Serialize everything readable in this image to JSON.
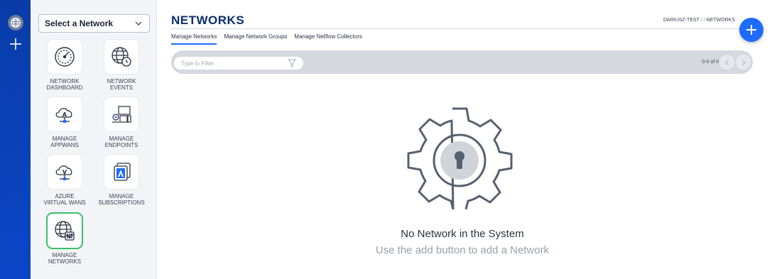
{
  "rail": {
    "icons": [
      "globe-icon",
      "plus-icon"
    ]
  },
  "sidebar": {
    "network_select": {
      "value": "Select a Network"
    },
    "tiles": [
      {
        "label": "NETWORK\nDASHBOARD",
        "icon": "dashboard-gauge-icon"
      },
      {
        "label": "NETWORK\nEVENTS",
        "icon": "globe-clock-icon"
      },
      {
        "label": "MANAGE\nAPPWANS",
        "icon": "cloud-a-icon"
      },
      {
        "label": "MANAGE\nENDPOINTS",
        "icon": "endpoints-devices-icon"
      },
      {
        "label": "AZURE\nVIRTUAL WANS",
        "icon": "cloud-v-icon"
      },
      {
        "label": "MANAGE\nSUBSCRIPTIONS",
        "icon": "subscriptions-azure-icon"
      },
      {
        "label": "MANAGE\nNETWORKS",
        "icon": "globe-sliders-icon",
        "active": true
      }
    ]
  },
  "header": {
    "title": "NETWORKS",
    "breadcrumb": {
      "org": "DARIUSZ-TEST",
      "sep": " / / ",
      "page": "NETWORKS"
    }
  },
  "tabs": [
    {
      "label": "Manage Networks",
      "active": true
    },
    {
      "label": "Manage Network Groups"
    },
    {
      "label": "Manage Netflow Collectors"
    }
  ],
  "toolbar": {
    "filter_placeholder": "Type to Filter",
    "count": "0-0 of 0"
  },
  "empty_state": {
    "title": "No Network in the System",
    "subtitle": "Use the add button to add a Network"
  },
  "colors": {
    "rail": "#0b46c9",
    "title": "#0b2e6f",
    "accent": "#1f6bff",
    "active_tile": "#38c06a",
    "toolbar": "#d5d8df"
  }
}
